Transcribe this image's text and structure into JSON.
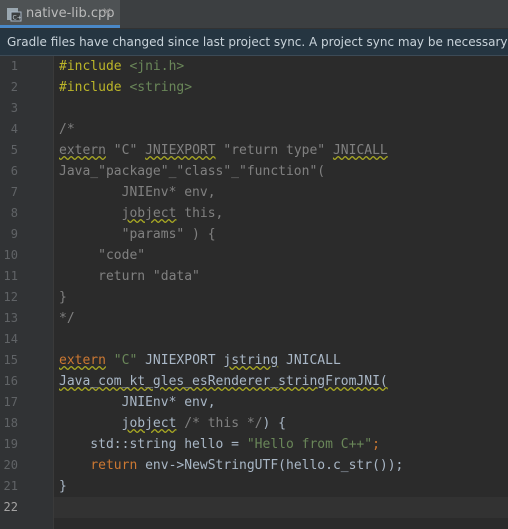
{
  "tab": {
    "filename": "native-lib.cpp",
    "close": "✕"
  },
  "banner": {
    "text": "Gradle files have changed since last project sync. A project sync may be necessary for the IDE"
  },
  "line_numbers": [
    "1",
    "2",
    "3",
    "4",
    "5",
    "6",
    "7",
    "8",
    "9",
    "10",
    "11",
    "12",
    "13",
    "14",
    "15",
    "16",
    "17",
    "18",
    "19",
    "20",
    "21",
    "22"
  ],
  "code": {
    "l1": [
      "#include ",
      "<jni.h>"
    ],
    "l2": [
      "#include ",
      "<string>"
    ],
    "l3": [],
    "l4": [
      "/*"
    ],
    "l5": [
      "extern",
      " \"C\" ",
      "JNIEXPORT",
      " \"return type\" ",
      "JNICALL"
    ],
    "l6": [
      "Java_\"package\"_\"class\"_\"function\"("
    ],
    "l7": [
      "        JNIEnv* env,"
    ],
    "l8": [
      "        ",
      "jobject",
      " this,"
    ],
    "l9": [
      "        \"params\" ) {"
    ],
    "l10": [
      "     \"code\""
    ],
    "l11": [
      "     return \"data\""
    ],
    "l12": [
      "}"
    ],
    "l13": [
      "*/"
    ],
    "l14": [],
    "l15": [
      "extern",
      " ",
      "\"C\"",
      " JNIEXPORT ",
      "jstring",
      " JNICALL"
    ],
    "l16": [
      "Java_com_kt_gles_esRenderer_stringFromJNI("
    ],
    "l17": [
      "        JNIEnv* env,"
    ],
    "l18": [
      "        ",
      "jobject",
      " ",
      "/* this */",
      ") {"
    ],
    "l19": [
      "    std::string hello = ",
      "\"Hello from C++\"",
      ";"
    ],
    "l20": [
      "    ",
      "return",
      " env->NewStringUTF(hello.c_str());"
    ],
    "l21": [
      "}"
    ],
    "l22": []
  }
}
